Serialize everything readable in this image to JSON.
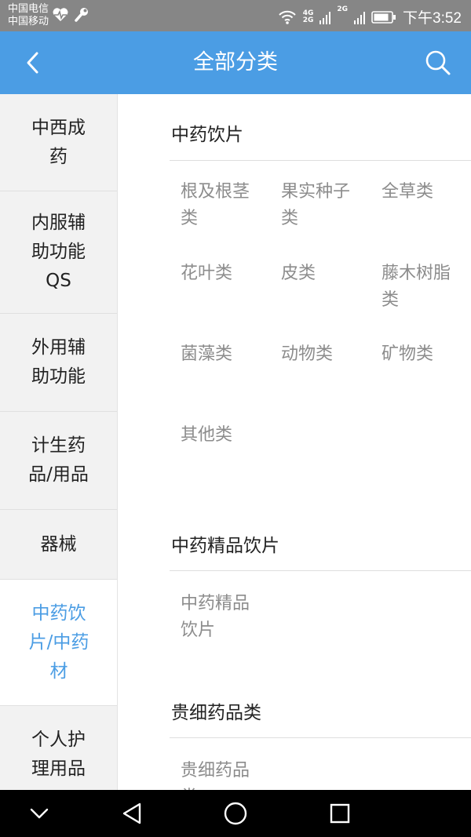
{
  "status_bar": {
    "carrier_1": "中国电信",
    "carrier_2": "中国移动",
    "net_1": "4G",
    "net_2": "2G",
    "net_3": "2G",
    "time": "下午3:52"
  },
  "app_bar": {
    "title": "全部分类"
  },
  "sidebar": {
    "items": [
      {
        "label": "中西成药",
        "active": false
      },
      {
        "label": "内服辅助功能QS",
        "active": false
      },
      {
        "label": "外用辅助功能",
        "active": false
      },
      {
        "label": "计生药品/用品",
        "active": false
      },
      {
        "label": "器械",
        "active": false
      },
      {
        "label": "中药饮片/中药材",
        "active": true
      },
      {
        "label": "个人护理用品",
        "active": false
      }
    ]
  },
  "sections": [
    {
      "title": "中药饮片",
      "categories": [
        "根及根茎类",
        "果实种子类",
        "全草类",
        "花叶类",
        "皮类",
        "藤木树脂类",
        "菌藻类",
        "动物类",
        "矿物类",
        "其他类"
      ]
    },
    {
      "title": "中药精品饮片",
      "categories": [
        "中药精品饮片"
      ]
    },
    {
      "title": "贵细药品类",
      "categories": [
        "贵细药品类"
      ]
    }
  ],
  "colors": {
    "accent": "#4b9de4",
    "status_bar": "#868686",
    "sidebar_bg": "#f2f2f2",
    "category_text": "#8c8c8c"
  },
  "icons": {
    "back": "chevron-left-icon",
    "search": "search-icon",
    "nav_back": "triangle-back-icon",
    "nav_home": "circle-home-icon",
    "nav_recent": "square-recent-icon",
    "nav_collapse": "chevron-down-icon"
  }
}
